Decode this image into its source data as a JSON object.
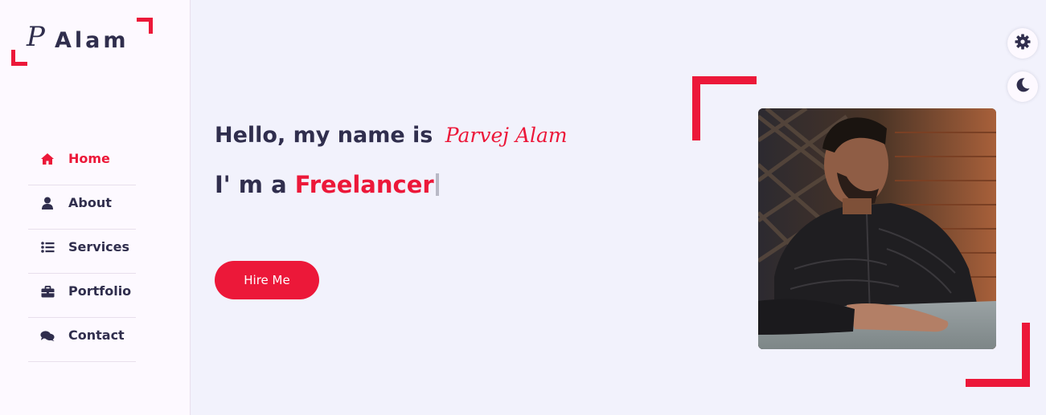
{
  "logo": {
    "initial": "P",
    "text": "Alam"
  },
  "nav": {
    "items": [
      {
        "label": "Home",
        "icon": "home-icon",
        "active": true
      },
      {
        "label": "About",
        "icon": "user-icon",
        "active": false
      },
      {
        "label": "Services",
        "icon": "list-icon",
        "active": false
      },
      {
        "label": "Portfolio",
        "icon": "briefcase-icon",
        "active": false
      },
      {
        "label": "Contact",
        "icon": "comments-icon",
        "active": false
      }
    ]
  },
  "toolbar": {
    "settings_icon": "gear-icon",
    "theme_icon": "moon-icon"
  },
  "hero": {
    "greeting_prefix": "Hello, my name is",
    "name": "Parvej Alam",
    "role_prefix": "I' m a",
    "role_typed": "Freelancer",
    "cta_label": "Hire Me"
  },
  "photo": {
    "subject": "profile-photo"
  },
  "colors": {
    "accent": "#ec1839",
    "text": "#302e4d",
    "background": "#f2f2fc",
    "sidebar": "#fdf9ff"
  }
}
